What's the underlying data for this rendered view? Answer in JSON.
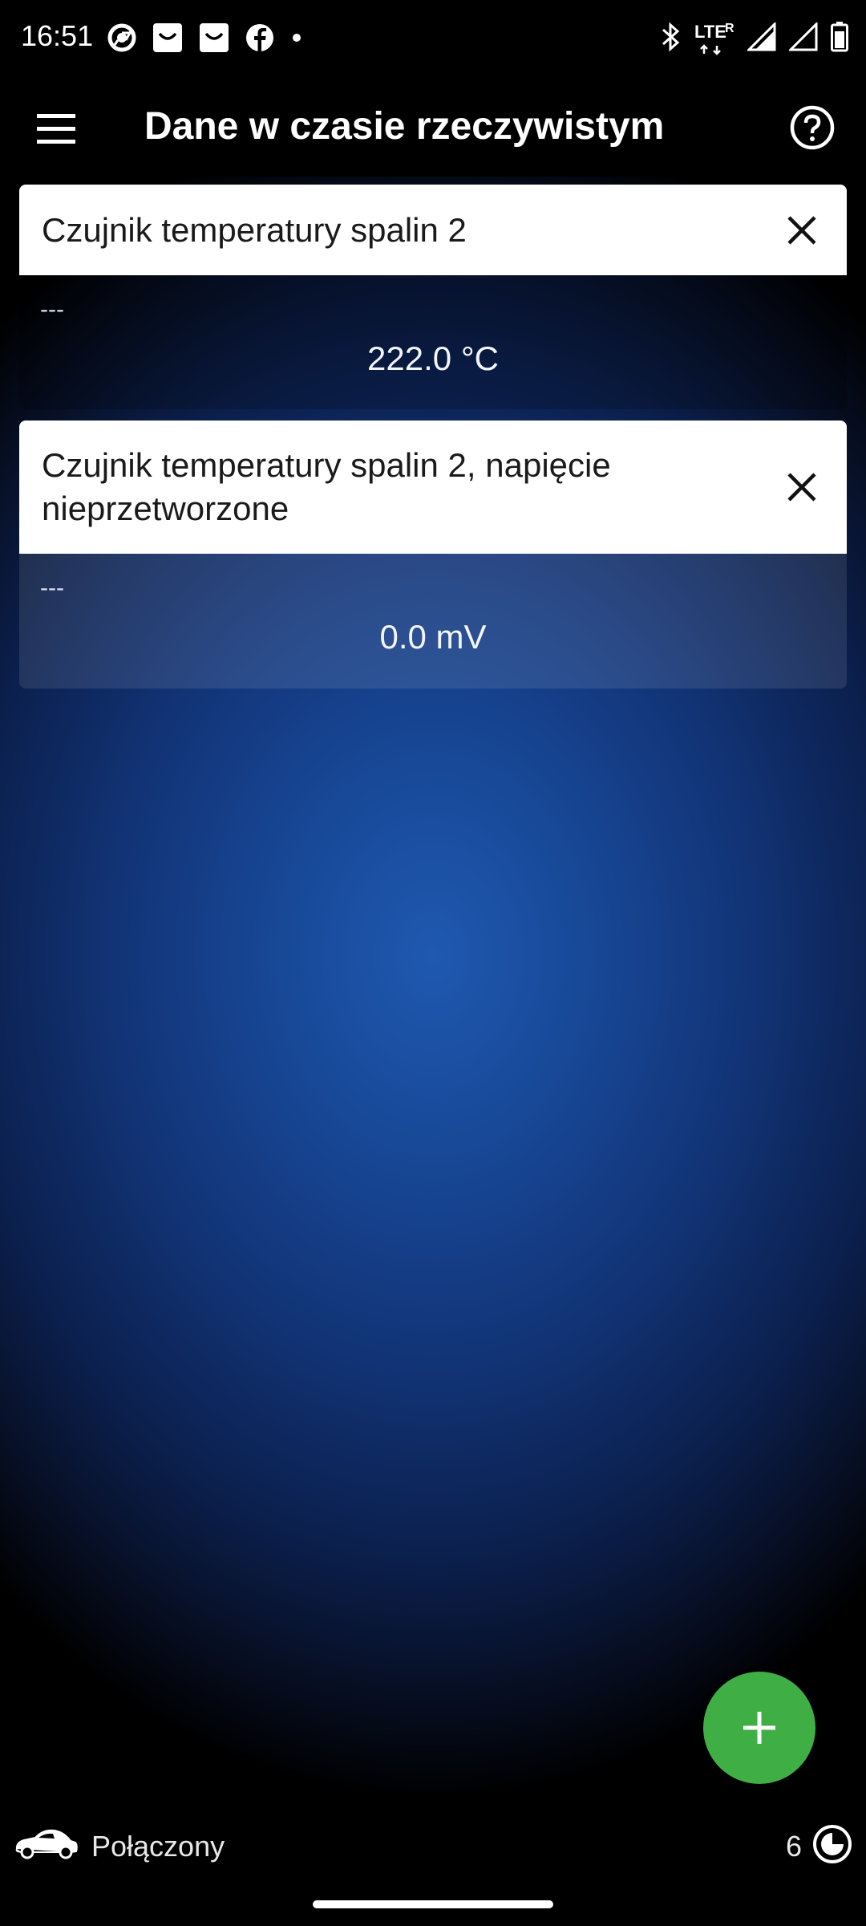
{
  "status_bar": {
    "time": "16:51",
    "network_label": "LTE",
    "roaming_label": "R",
    "left_icons": [
      "chrome-icon",
      "mail-icon",
      "mail-icon",
      "facebook-icon",
      "dot-icon"
    ],
    "right_icons": [
      "bluetooth-icon",
      "lte-roaming-icon",
      "signal-icon",
      "signal-icon",
      "battery-icon"
    ]
  },
  "app_bar": {
    "title": "Dane w czasie rzeczywistym",
    "menu_icon": "menu-icon",
    "help_icon": "help-icon"
  },
  "cards": [
    {
      "title": "Czujnik temperatury spalin 2",
      "subtitle": "---",
      "value": "222.0 °C"
    },
    {
      "title": "Czujnik temperatury spalin 2, napięcie nieprzetworzone",
      "subtitle": "---",
      "value": "0.0 mV"
    }
  ],
  "fab": {
    "icon": "plus-icon"
  },
  "bottom_bar": {
    "status": "Połączony",
    "count": "6",
    "car_icon": "car-icon",
    "stop_icon": "stop-icon"
  },
  "colors": {
    "fab": "#3fae45",
    "background_center": "#1f59b0",
    "header_bg": "#000000",
    "card_header_bg": "#ffffff"
  }
}
